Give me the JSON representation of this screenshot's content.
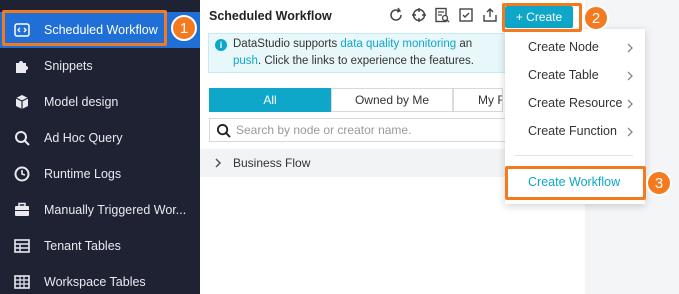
{
  "sidebar": {
    "items": [
      {
        "label": "Scheduled Workflow",
        "icon": "code-icon",
        "active": true
      },
      {
        "label": "Snippets",
        "icon": "puzzle-icon"
      },
      {
        "label": "Model design",
        "icon": "cube-icon"
      },
      {
        "label": "Ad Hoc Query",
        "icon": "search-icon"
      },
      {
        "label": "Runtime Logs",
        "icon": "clock-icon"
      },
      {
        "label": "Manually Triggered Wor...",
        "icon": "briefcase-icon"
      },
      {
        "label": "Tenant Tables",
        "icon": "table-icon"
      },
      {
        "label": "Workspace Tables",
        "icon": "grid-icon"
      }
    ]
  },
  "header": {
    "title": "Scheduled Workflow",
    "create_label": "+ Create",
    "toolbar_icons": [
      "refresh-icon",
      "locate-icon",
      "doc-search-icon",
      "checklist-icon",
      "import-icon"
    ]
  },
  "info": {
    "prefix": "DataStudio supports ",
    "link1": "data quality monitoring",
    "mid": " an",
    "link2": "push",
    "suffix": ". Click the links to experience the features."
  },
  "tabs": [
    "All",
    "Owned by Me",
    "My F"
  ],
  "search": {
    "placeholder": "Search by node or creator name."
  },
  "tree": {
    "root_label": "Business Flow"
  },
  "dropdown": {
    "items": [
      "Create Node",
      "Create Table",
      "Create Resource",
      "Create Function"
    ],
    "workflow_label": "Create Workflow"
  },
  "callouts": [
    "1",
    "2",
    "3"
  ],
  "colors": {
    "accent": "#0ea7c9",
    "callout": "#f47a1f",
    "sidebar_bg": "#1f2233",
    "active_bg": "#1f6fd6"
  }
}
